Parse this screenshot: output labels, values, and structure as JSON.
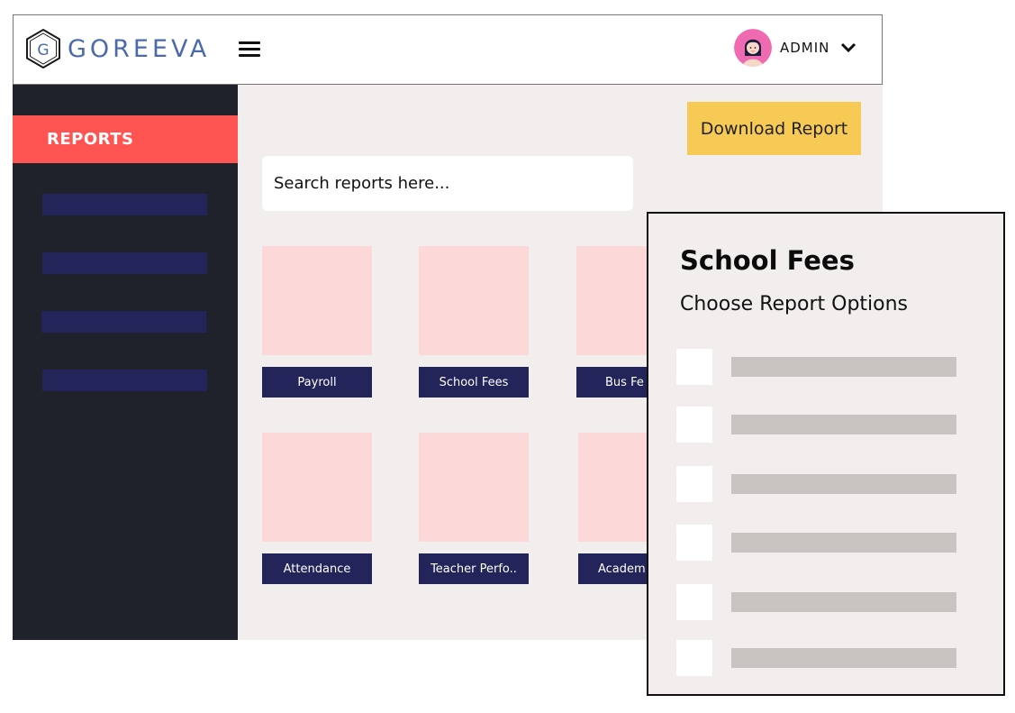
{
  "header": {
    "logo_text": "GOREEVA",
    "logo_letter": "G",
    "user_label": "ADMIN",
    "icons": {
      "menu": "hamburger-icon",
      "chevron": "chevron-down-icon",
      "avatar": "avatar-icon"
    }
  },
  "sidebar": {
    "active_item": "REPORTS",
    "placeholder_items": 4
  },
  "main": {
    "download_label": "Download Report",
    "search_placeholder": "Search reports here...",
    "reports": [
      {
        "label": "Payroll"
      },
      {
        "label": "School Fees"
      },
      {
        "label": "Bus Fe"
      },
      {
        "label": "Attendance"
      },
      {
        "label": "Teacher Perfo.."
      },
      {
        "label": "Academ"
      }
    ]
  },
  "panel": {
    "title": "School Fees",
    "subtitle": "Choose Report Options",
    "option_count": 6
  },
  "colors": {
    "accent": "#ff5552",
    "sidebar_bg": "#1f222b",
    "navy": "#22245a",
    "button_yellow": "#f7c955",
    "thumb_pink": "#fdd8d8",
    "logo_blue": "#4b6aab"
  }
}
